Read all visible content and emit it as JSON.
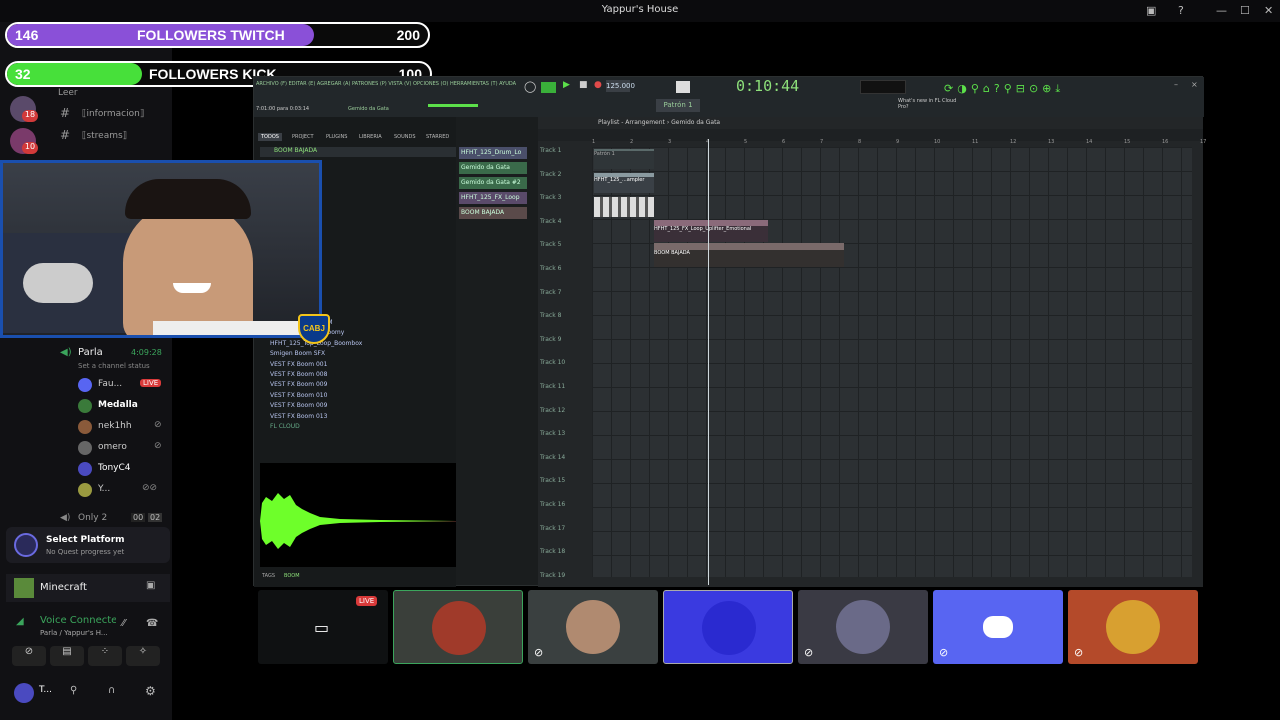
{
  "window": {
    "title": "Yappur's House"
  },
  "overlay": {
    "twitch": {
      "count": "146",
      "label": "FOLLOWERS TWITCH",
      "goal": "200",
      "progress": 0.73
    },
    "kick": {
      "count": "32",
      "label": "FOLLOWERS KICK",
      "goal": "100",
      "progress": 0.32
    },
    "colors": {
      "twitch": "#8a50d8",
      "kick": "#47e03a"
    }
  },
  "sidebar": {
    "read_label": "Leer",
    "badges": [
      "18",
      "10"
    ],
    "channels": [
      "⟦informacion⟧",
      "⟦streams⟧"
    ],
    "voice_channel": {
      "name": "Parla",
      "time": "4:09:28",
      "status": "Set a channel status"
    },
    "users": [
      {
        "name": "Fau...",
        "live": "LIVE"
      },
      {
        "name": "Medalla"
      },
      {
        "name": "nek1hh"
      },
      {
        "name": "omero"
      },
      {
        "name": "TonyC4"
      },
      {
        "name": "Y..."
      }
    ],
    "only2": {
      "name": "Only 2",
      "a": "00",
      "b": "02"
    },
    "quest": {
      "title": "Select Platform",
      "subtitle": "No Quest progress yet"
    },
    "activity": "Minecraft",
    "voice": {
      "title": "Voice Connected",
      "subtitle": "Parla / Yappur's H..."
    },
    "user_short": "T..."
  },
  "daw": {
    "menu": "ARCHIVO (F) EDITAR (E) AGREGAR (A) PATRONES (P) VISTA (V) OPCIONES (O) HERRAMIENTAS (T) AYUDA",
    "song_pos": "7:01:00 para 0:03:14",
    "project": "Gemido da Gata",
    "tempo": "125.000",
    "time": "0:10:44",
    "pattern": "Patrón 1",
    "news": "What's new in FL Cloud Pro?",
    "browser_tabs": [
      "TODOS",
      "PROJECT",
      "PLUGINS",
      "LIBRERIA",
      "SOUNDS",
      "STARRED"
    ],
    "browser_path": "BOOM BAJADA",
    "browser_items": [
      "TION",
      "Boom 01",
      "Boom 02",
      "Boom 03",
      "Boom 04",
      "at",
      "ave high",
      "ave low",
      "8 01",
      "8 02",
      "lash",
      "ure 01",
      "ure 02",
      "ure 03",
      "nehouse",
      "FX Boom 009 ... BPM",
      "Gated Bright and Boomy",
      "HFHT_125_Top_Loop_Boombox",
      "Smigen Boom SFX",
      "VEST FX Boom 001",
      "VEST FX Boom 008",
      "VEST FX Boom 009",
      "VEST FX Boom 010",
      "VEST FX Boom 009",
      "VEST FX Boom 013",
      "FL CLOUD"
    ],
    "tags_label": "TAGS",
    "tag": "BOOM",
    "channels": [
      "HFHT_125_Drum_Lo",
      "Gemido da Gata",
      "Gemido da Gata #2",
      "HFHT_125_FX_Loop",
      "BOOM BAJADA"
    ],
    "playlist_title": "Playlist - Arrangement › Gemido da Gata",
    "tracks": [
      "Track 1",
      "Track 2",
      "Track 3",
      "Track 4",
      "Track 5",
      "Track 6",
      "Track 7",
      "Track 8",
      "Track 9",
      "Track 10",
      "Track 11",
      "Track 12",
      "Track 13",
      "Track 14",
      "Track 15",
      "Track 16",
      "Track 17",
      "Track 18",
      "Track 19"
    ],
    "bars": [
      "1",
      "2",
      "3",
      "4",
      "5",
      "6",
      "7",
      "8",
      "9",
      "10",
      "11",
      "12",
      "13",
      "14",
      "15",
      "16",
      "17"
    ],
    "clips": [
      "Patrón 1",
      "HFHT_125_...ampler",
      "HFHT_125_FX_Loop_Uplifter_Emotional",
      "BOOM BAJADA"
    ]
  },
  "webcam": {
    "badge": "CABJ"
  },
  "tiles": {
    "live": "LIVE"
  }
}
